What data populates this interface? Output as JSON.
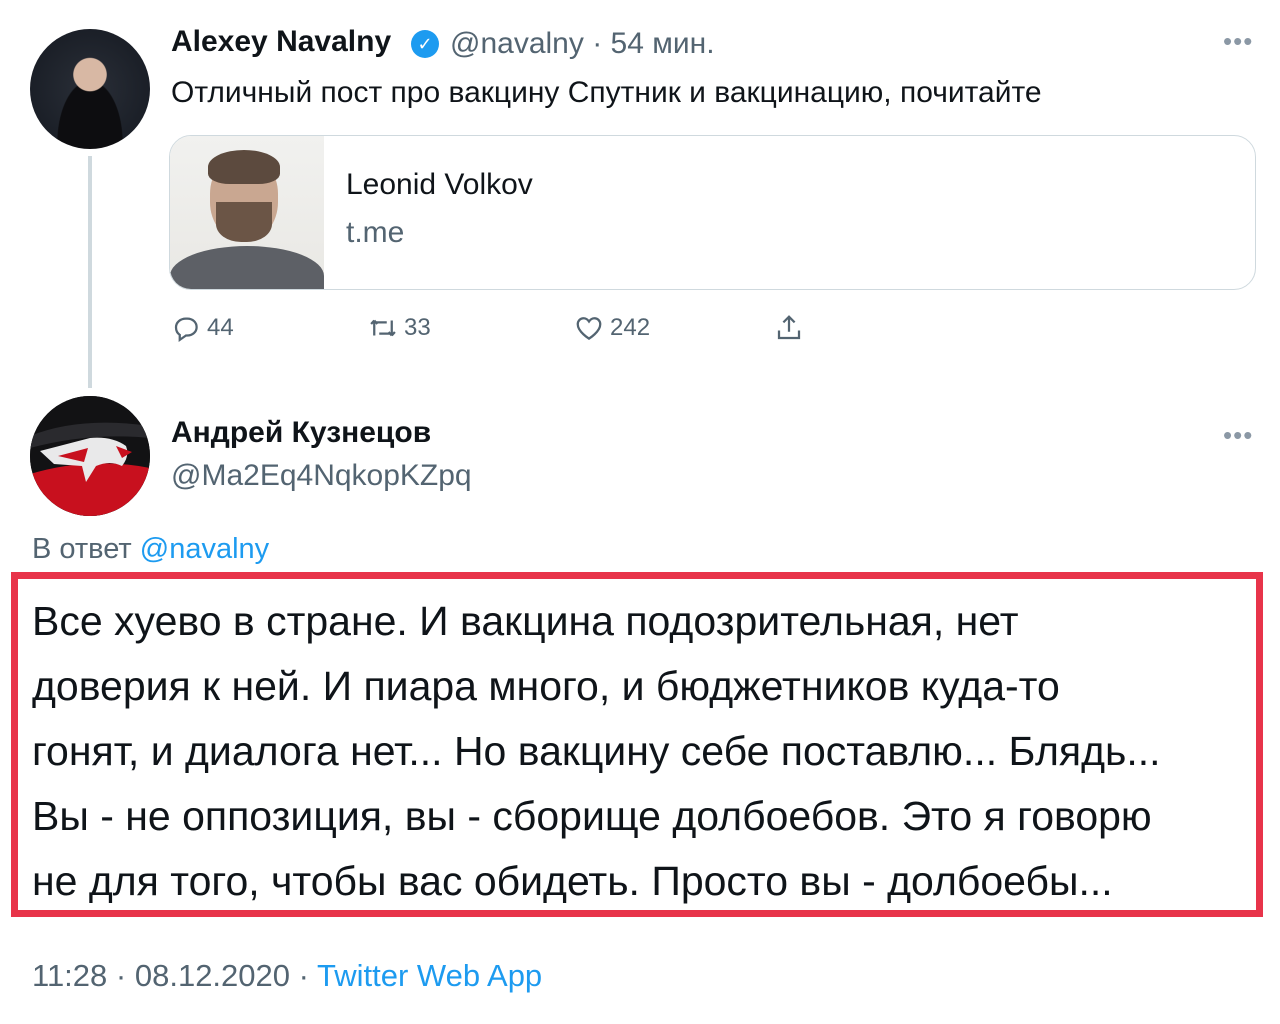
{
  "tweet1": {
    "author_name": "Alexey Navalny",
    "verified_glyph": "✓",
    "handle": "@navalny",
    "separator": "·",
    "time_ago": "54 мин.",
    "more_glyph": "•••",
    "text": "Отличный пост про вакцину Спутник и вакцинацию, почитайте",
    "link_card": {
      "title": "Leonid Volkov",
      "domain": "t.me"
    },
    "actions": {
      "replies": "44",
      "retweets": "33",
      "likes": "242"
    }
  },
  "tweet2": {
    "author_name": "Андрей Кузнецов",
    "handle": "@Ma2Eq4NqkopKZpq",
    "more_glyph": "•••",
    "reply_prefix": "В ответ",
    "reply_mention": "@navalny",
    "text_lines": [
      "Все хуево в стране. И вакцина подозрительная, нет",
      "доверия к ней. И пиара много, и бюджетников куда-то",
      "гонят, и диалога нет... Но вакцину себе поставлю... Блядь...",
      "Вы - не оппозиция, вы - сборище долбоебов. Это я говорю",
      "не для того, чтобы вас обидеть. Просто вы - долбоебы..."
    ],
    "time": "11:28",
    "date": "08.12.2020",
    "separator": "·",
    "source": "Twitter Web App"
  },
  "colors": {
    "accent": "#1d9bf0",
    "highlight_border": "#e8344a",
    "secondary_text": "#536471"
  },
  "icons": [
    "reply-icon",
    "retweet-icon",
    "like-icon",
    "share-icon",
    "verified-icon",
    "more-icon"
  ]
}
